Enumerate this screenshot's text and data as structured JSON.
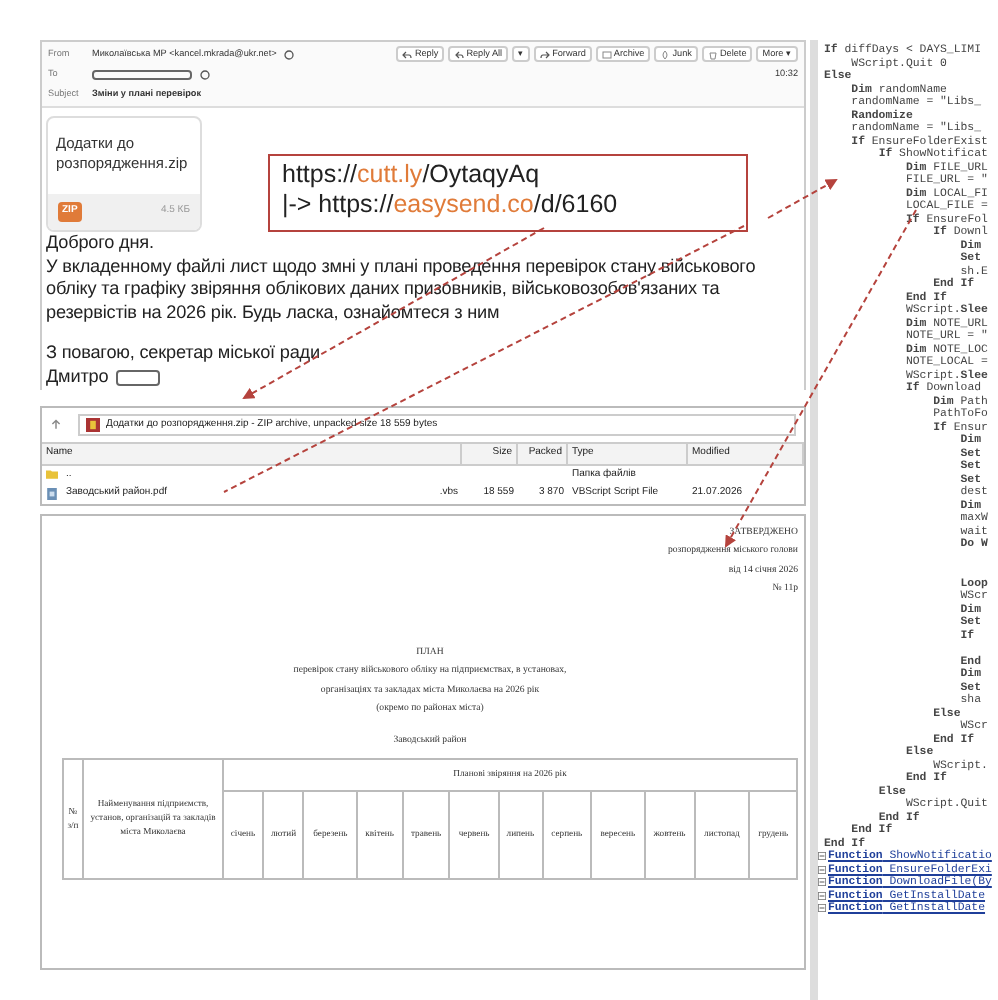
{
  "email": {
    "from_label": "From",
    "sender": "Миколаївська МР <kancel.mkrada@ukr.net>",
    "to_label": "To",
    "subject_label": "Subject",
    "subject": "Зміни у плані перевірок",
    "time": "10:32",
    "actions": [
      "Reply",
      "Reply All",
      "▾",
      "Forward",
      "Archive",
      "Junk",
      "Delete",
      "More ▾"
    ],
    "attachment": {
      "name": "Додатки до розпорядження.zip",
      "badge": "ZIP",
      "size": "4.5 КБ"
    },
    "callout": [
      [
        {
          "text": "https://",
          "highlight": false
        },
        {
          "text": "cutt.ly",
          "highlight": true
        },
        {
          "text": "/OytaqyAq",
          "highlight": false
        }
      ],
      [
        {
          "text": "|-> https://",
          "highlight": false
        },
        {
          "text": "easysend.co",
          "highlight": true
        },
        {
          "text": "/d/6160",
          "highlight": false
        }
      ]
    ],
    "greeting": "Доброго дня.",
    "body": "У вкладенному файлі лист щодо змні у плані проведення перевірок стану військового обліку та графіку звіряння облікових даних призовників, військовозобов'язаних та резервістів на 2026 рік. Будь ласка, ознайомтеся з ним",
    "closing": "З повагою, секретар міської ради",
    "signature": "Дмитро"
  },
  "archive": {
    "path": "Додатки до розпорядження.zip - ZIP archive, unpacked size 18 559 bytes",
    "columns": [
      "Name",
      "Size",
      "Packed",
      "Type",
      "Modified"
    ],
    "rows": [
      {
        "kind": "folder",
        "name": "..",
        "ext": "",
        "size": "",
        "packed": "",
        "type": "Папка файлів",
        "modified": ""
      },
      {
        "kind": "script",
        "name": "Заводський район.pdf",
        "ext": ".vbs",
        "size": "18 559",
        "packed": "3 870",
        "type": "VBScript Script File",
        "modified": "21.07.2026"
      }
    ]
  },
  "document": {
    "approved": [
      "ЗАТВЕРДЖЕНО",
      "розпорядження міського голови",
      "від 14 січня 2026",
      "№ 11р"
    ],
    "title": "ПЛАН",
    "subtitle": [
      "перевірок стану військового обліку на підприємствах, в установах,",
      "організаціях та закладах міста Миколаєва на 2026 рік",
      "(окремо по районах міста)"
    ],
    "district": "Заводський район",
    "col_no": "№ з/п",
    "col_name": "Найменування підприємств, установ, організацій та закладів міста Миколаєва",
    "col_plan": "Планові звіряння на 2026 рік",
    "months": [
      "січень",
      "лютий",
      "березень",
      "квітень",
      "травень",
      "червень",
      "липень",
      "серпень",
      "вересень",
      "жовтень",
      "листопад",
      "грудень"
    ]
  },
  "code": [
    {
      "kind": "code",
      "text": "**If** diffDays < DAYS_LIMI"
    },
    {
      "kind": "code",
      "text": "    WScript.Quit 0"
    },
    {
      "kind": "code",
      "text": "**Else**"
    },
    {
      "kind": "code",
      "text": "    **Dim** randomName"
    },
    {
      "kind": "code",
      "text": "    randomName = \"Libs_"
    },
    {
      "kind": "code",
      "text": "    **Randomize**"
    },
    {
      "kind": "code",
      "text": "    randomName = \"Libs_"
    },
    {
      "kind": "code",
      "text": "    **If** EnsureFolderExist"
    },
    {
      "kind": "code",
      "text": "        **If** ShowNotificat"
    },
    {
      "kind": "code",
      "text": "            **Dim** FILE_URL"
    },
    {
      "kind": "code",
      "text": "            FILE_URL = \""
    },
    {
      "kind": "code",
      "text": "            **Dim** LOCAL_FI"
    },
    {
      "kind": "code",
      "text": "            LOCAL_FILE ="
    },
    {
      "kind": "code",
      "text": "            **If** EnsureFol"
    },
    {
      "kind": "code",
      "text": "                **If** Downl"
    },
    {
      "kind": "code",
      "text": "                    **Dim**"
    },
    {
      "kind": "code",
      "text": "                    **Set**"
    },
    {
      "kind": "code",
      "text": "                    sh.E"
    },
    {
      "kind": "code",
      "text": "                **End If**"
    },
    {
      "kind": "code",
      "text": "            **End If**"
    },
    {
      "kind": "code",
      "text": "            WScript.**Slee**"
    },
    {
      "kind": "code",
      "text": "            **Dim** NOTE_URL"
    },
    {
      "kind": "code",
      "text": "            NOTE_URL = \""
    },
    {
      "kind": "code",
      "text": "            **Dim** NOTE_LOC"
    },
    {
      "kind": "code",
      "text": "            NOTE_LOCAL ="
    },
    {
      "kind": "code",
      "text": "            WScript.**Slee**"
    },
    {
      "kind": "code",
      "text": "            **If** Download"
    },
    {
      "kind": "code",
      "text": "                **Dim** Path"
    },
    {
      "kind": "code",
      "text": "                PathToFo"
    },
    {
      "kind": "code",
      "text": "                **If** Ensur"
    },
    {
      "kind": "code",
      "text": "                    **Dim**"
    },
    {
      "kind": "code",
      "text": "                    **Set**"
    },
    {
      "kind": "code",
      "text": "                    **Set**"
    },
    {
      "kind": "code",
      "text": "                    **Set**"
    },
    {
      "kind": "code",
      "text": "                    dest"
    },
    {
      "kind": "code",
      "text": "                    **Dim**"
    },
    {
      "kind": "code",
      "text": "                    maxW"
    },
    {
      "kind": "code",
      "text": "                    wait"
    },
    {
      "kind": "code",
      "text": "                    **Do W**"
    },
    {
      "kind": "blank"
    },
    {
      "kind": "blank"
    },
    {
      "kind": "code",
      "text": "                    **Loop**"
    },
    {
      "kind": "code",
      "text": "                    WScr"
    },
    {
      "kind": "code",
      "text": "                    **Dim**"
    },
    {
      "kind": "code",
      "text": "                    **Set**"
    },
    {
      "kind": "code",
      "text": "                    **If**"
    },
    {
      "kind": "blank"
    },
    {
      "kind": "code",
      "text": "                    **End**"
    },
    {
      "kind": "code",
      "text": "                    **Dim**"
    },
    {
      "kind": "code",
      "text": "                    **Set**"
    },
    {
      "kind": "code",
      "text": "                    sha"
    },
    {
      "kind": "code",
      "text": "                **Else**"
    },
    {
      "kind": "code",
      "text": "                    WScr"
    },
    {
      "kind": "code",
      "text": "                **End If**"
    },
    {
      "kind": "code",
      "text": "            **Else**"
    },
    {
      "kind": "code",
      "text": "                WScript."
    },
    {
      "kind": "code",
      "text": "            **End If**"
    },
    {
      "kind": "code",
      "text": "        **Else**"
    },
    {
      "kind": "code",
      "text": "            WScript.Quit"
    },
    {
      "kind": "code",
      "text": "        **End If**"
    },
    {
      "kind": "code",
      "text": "    **End If**"
    },
    {
      "kind": "code",
      "text": "**End If**"
    },
    {
      "kind": "function",
      "text": "**Function** ShowNotificatio"
    },
    {
      "kind": "function",
      "text": "**Function** EnsureFolderExi"
    },
    {
      "kind": "function",
      "text": "**Function** DownloadFile(By"
    },
    {
      "kind": "function",
      "text": "**Function** GetInstallDate"
    },
    {
      "kind": "function",
      "text": "**Function** GetInstallDate"
    }
  ]
}
